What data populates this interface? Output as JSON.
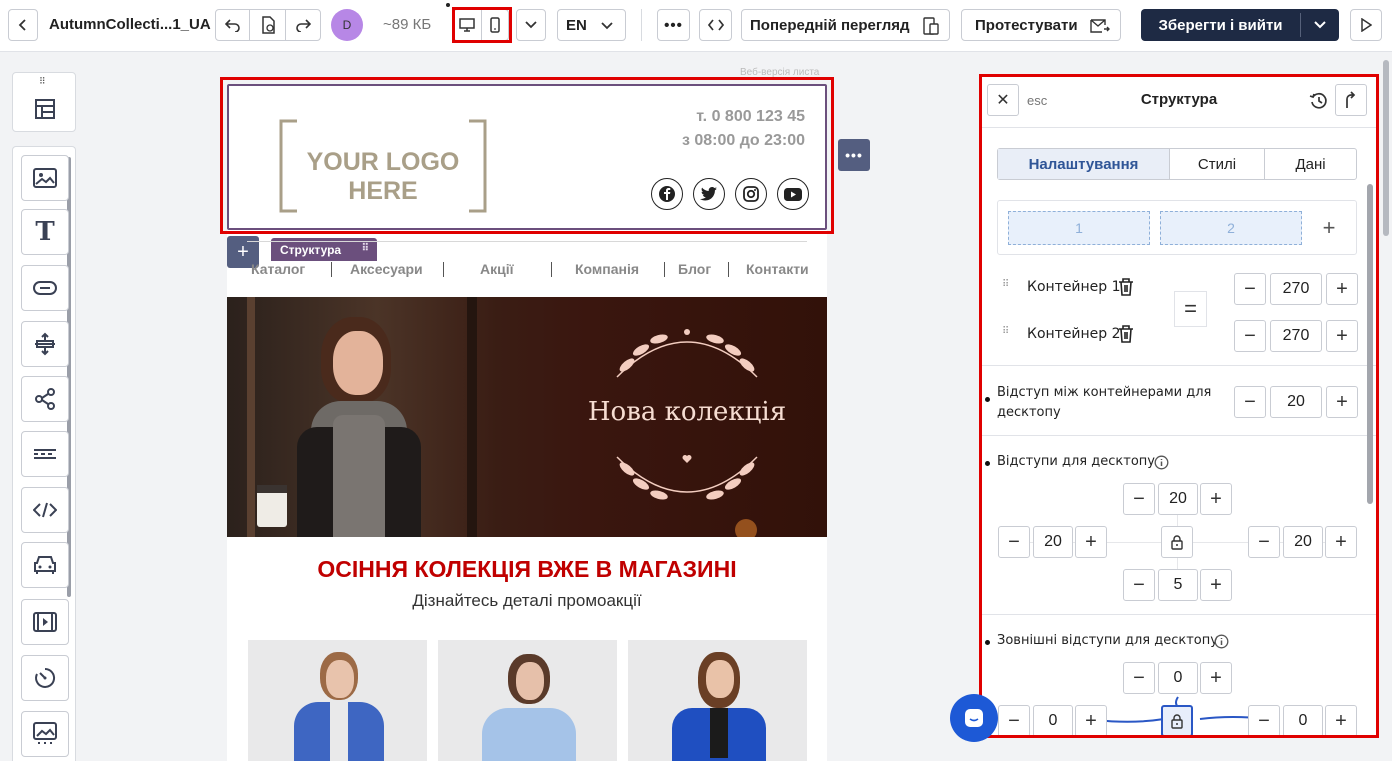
{
  "topbar": {
    "filename": "AutumnCollecti...1_UA",
    "avatar_letter": "D",
    "size": "~89 КБ",
    "language": "EN",
    "preview_label": "Попередній перегляд",
    "test_label": "Протестувати",
    "save_label": "Зберегти і вийти"
  },
  "canvas": {
    "web_version": "Веб-версія листа",
    "logo_text": "YOUR LOGO HERE",
    "phone": "т. 0 800 123 45",
    "hours": "з 08:00 до 23:00",
    "structure_tag": "Структура",
    "nav": [
      "Каталог",
      "Аксесуари",
      "Акції",
      "Компанія",
      "Блог",
      "Контакти"
    ],
    "banner_title": "Нова колекція",
    "headline": "ОСІННЯ КОЛЕКЦІЯ ВЖЕ В МАГАЗИНІ",
    "subheadline": "Дізнайтесь деталі промоакції"
  },
  "panel": {
    "esc": "esc",
    "title": "Структура",
    "tabs": [
      "Налаштування",
      "Стилі",
      "Дані"
    ],
    "columns": [
      "1",
      "2"
    ],
    "containers": [
      {
        "label": "Контейнер 1",
        "value": "270"
      },
      {
        "label": "Контейнер 2",
        "value": "270"
      }
    ],
    "gap_label": "Відступ між контейнерами для десктопу",
    "gap_value": "20",
    "padding_label": "Відступи для десктопу",
    "padding": {
      "top": "20",
      "left": "20",
      "right": "20",
      "bottom": "5"
    },
    "margin_label": "Зовнішні відступи для десктопу",
    "margin": {
      "top": "0",
      "left": "0",
      "right": "0"
    }
  },
  "colors": {
    "accent_dark": "#1e2a44",
    "highlight_red": "#e00000",
    "tab_active": "#2f5597",
    "structure_purple": "#6b4f7d",
    "headline_red": "#c00000",
    "banner_bg": "#3a160f"
  }
}
